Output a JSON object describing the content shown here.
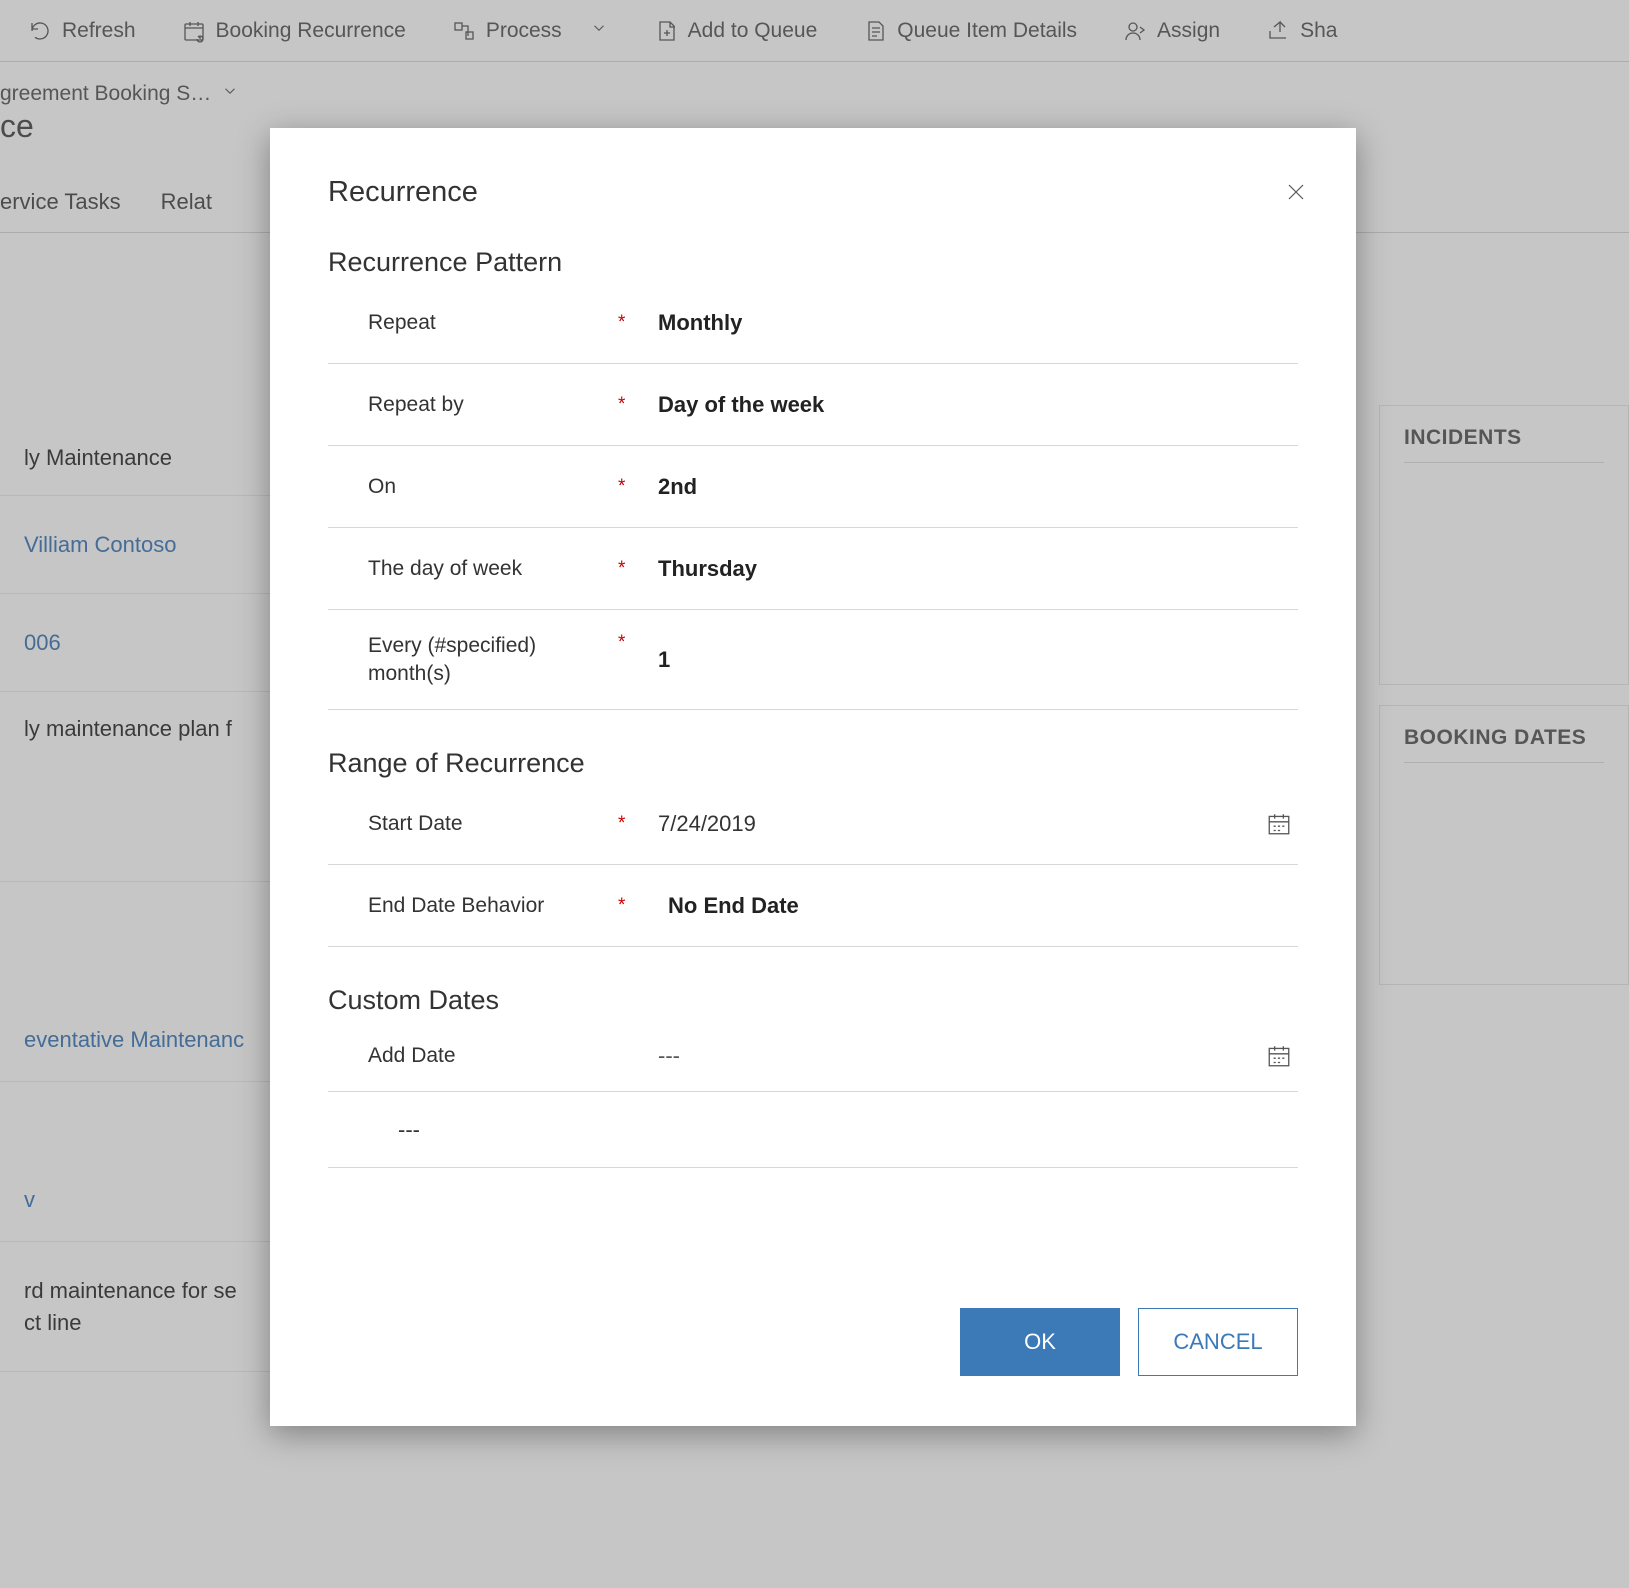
{
  "toolbar": {
    "refresh": "Refresh",
    "booking_recurrence": "Booking Recurrence",
    "process": "Process",
    "add_to_queue": "Add to Queue",
    "queue_item_details": "Queue Item Details",
    "assign": "Assign",
    "share": "Sha"
  },
  "header": {
    "breadcrumb": "greement Booking S…",
    "title": "ce"
  },
  "tabs": {
    "service_tasks": "ervice Tasks",
    "related": "Relat"
  },
  "fields": {
    "row1": "ly Maintenance",
    "row2": "Villiam Contoso",
    "row3": "006",
    "row4": "ly maintenance plan f",
    "row5": "eventative Maintenanc",
    "row6": "v",
    "row7a": "rd maintenance for se",
    "row7b": "ct line"
  },
  "panels": {
    "incidents": "INCIDENTS",
    "booking_dates": "BOOKING DATES"
  },
  "modal": {
    "title": "Recurrence",
    "sections": {
      "pattern": "Recurrence Pattern",
      "range": "Range of Recurrence",
      "custom": "Custom Dates"
    },
    "labels": {
      "repeat": "Repeat",
      "repeat_by": "Repeat by",
      "on": "On",
      "day_of_week": "The day of week",
      "every_months": "Every (#specified) month(s)",
      "start_date": "Start Date",
      "end_date_behavior": "End Date Behavior",
      "add_date": "Add Date"
    },
    "values": {
      "repeat": "Monthly",
      "repeat_by": "Day of the week",
      "on": "2nd",
      "day_of_week": "Thursday",
      "every_months": "1",
      "start_date": "7/24/2019",
      "end_date_behavior": "No End Date",
      "add_date": "---",
      "custom_row": "---"
    },
    "required_mark": "*",
    "buttons": {
      "ok": "OK",
      "cancel": "CANCEL"
    }
  }
}
